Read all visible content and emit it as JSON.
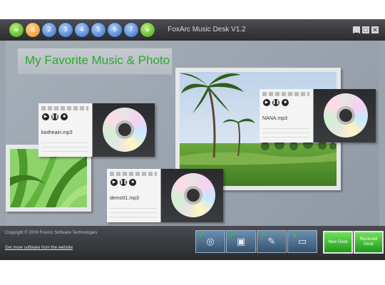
{
  "window": {
    "title": "FoxArc Music Desk V1.2",
    "nav_buttons": [
      {
        "label": "«",
        "name": "prev-desk-button",
        "kind": "arrow"
      },
      {
        "label": "⌂",
        "name": "home-desk-button",
        "kind": "home"
      },
      {
        "label": "2",
        "name": "desk-2-button",
        "kind": "num"
      },
      {
        "label": "3",
        "name": "desk-3-button",
        "kind": "num"
      },
      {
        "label": "4",
        "name": "desk-4-button",
        "kind": "num"
      },
      {
        "label": "5",
        "name": "desk-5-button",
        "kind": "num"
      },
      {
        "label": "6",
        "name": "desk-6-button",
        "kind": "num"
      },
      {
        "label": "7",
        "name": "desk-7-button",
        "kind": "num"
      },
      {
        "label": "»",
        "name": "next-desk-button",
        "kind": "arrow"
      }
    ],
    "controls": {
      "minimize": "▁",
      "restore": "□",
      "close": "✕"
    }
  },
  "desk": {
    "banner": "My Favorite Music & Photo",
    "players": [
      {
        "track": "kiotheain.mp3"
      },
      {
        "track": "NANA.mp3"
      },
      {
        "track": "demo01.mp3"
      }
    ],
    "player_controls": {
      "play": "▶",
      "pause": "❚❚",
      "stop": "■"
    }
  },
  "footer": {
    "copyright": "Copyright © 2009 FoxArc Software Technologies",
    "get_more": "Get more software from the website",
    "tools": [
      {
        "icon": "add-music-icon",
        "glyph": "◎"
      },
      {
        "icon": "add-photo-icon",
        "glyph": "▣"
      },
      {
        "icon": "add-note-icon",
        "glyph": "✎"
      },
      {
        "icon": "set-background-icon",
        "glyph": "▭"
      }
    ],
    "new_desk": "New Desk",
    "restore_desk": "Restored Desk"
  },
  "colors": {
    "banner_text": "#2ea82e",
    "accent_green": "#39c526",
    "titlebar": "#2b2c30"
  }
}
